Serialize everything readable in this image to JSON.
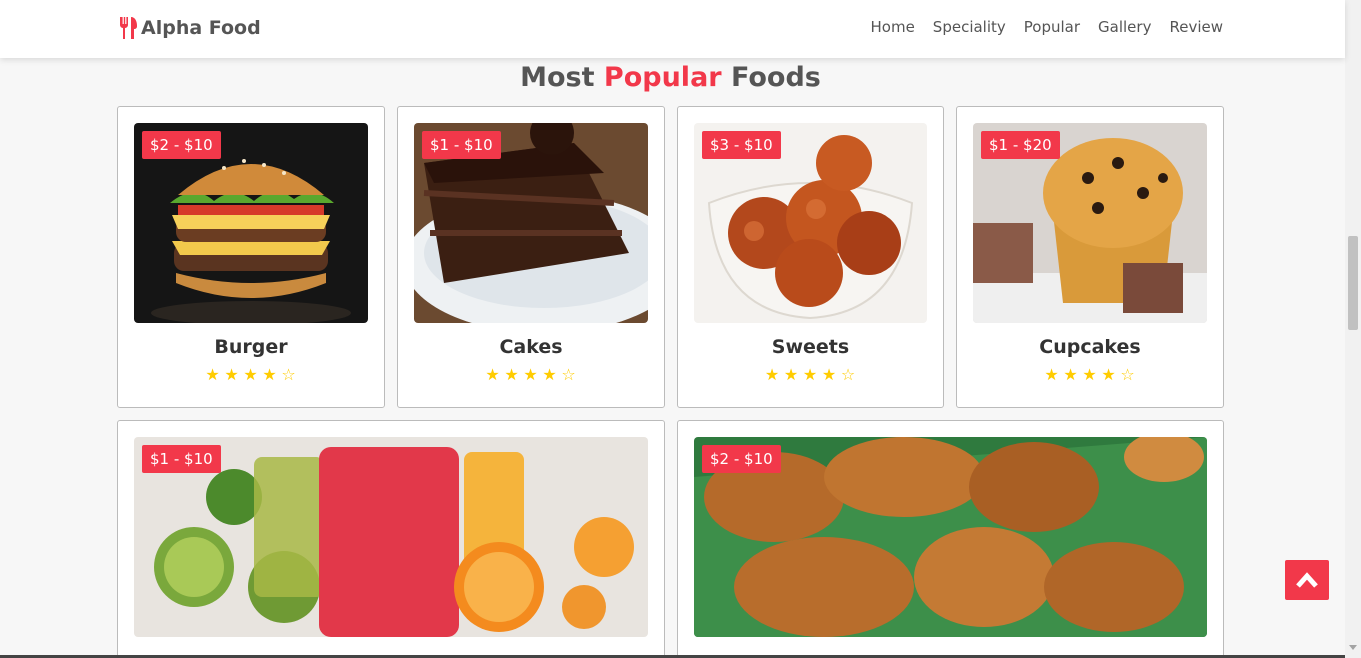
{
  "brand": {
    "name": "Alpha Food",
    "icon": "utensils-icon"
  },
  "nav": {
    "links": [
      {
        "label": "Home"
      },
      {
        "label": "Speciality"
      },
      {
        "label": "Popular"
      },
      {
        "label": "Gallery"
      },
      {
        "label": "Review"
      }
    ]
  },
  "heading": {
    "part1": "Most ",
    "accent": "Popular",
    "part2": " Foods"
  },
  "colors": {
    "accent": "#f2384a",
    "star": "#ffcc00"
  },
  "cards": [
    {
      "name": "Burger",
      "price": "$2 - $10",
      "rating": 4,
      "max_rating": 5
    },
    {
      "name": "Cakes",
      "price": "$1 - $10",
      "rating": 4,
      "max_rating": 5
    },
    {
      "name": "Sweets",
      "price": "$3 - $10",
      "rating": 4,
      "max_rating": 5
    },
    {
      "name": "Cupcakes",
      "price": "$1 - $20",
      "rating": 4,
      "max_rating": 5
    },
    {
      "name": "",
      "price": "$1 - $10"
    },
    {
      "name": "",
      "price": "$2 - $10"
    }
  ],
  "scroll_top": {
    "icon": "chevron-up-icon"
  }
}
